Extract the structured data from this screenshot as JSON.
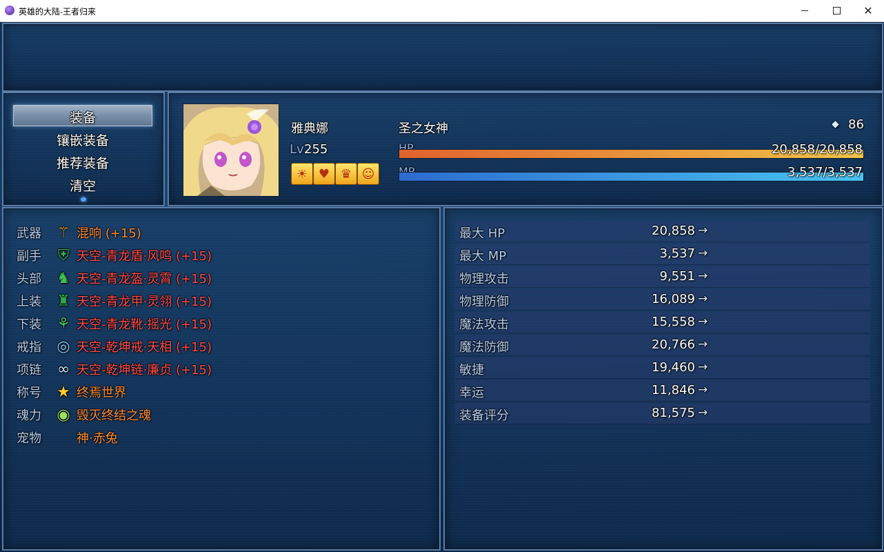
{
  "window": {
    "title": "英雄的大陆-王者归来"
  },
  "commands": [
    "装备",
    "镶嵌装备",
    "推荐装备",
    "清空"
  ],
  "actor": {
    "name": "雅典娜",
    "level_label": "Lv",
    "level": "255",
    "class": "圣之女神",
    "gems": "86",
    "hp_label": "HP",
    "hp_text": "20,858/20,858",
    "hp_ratio": 1.0,
    "mp_label": "MP",
    "mp_text": "3,537/3,537",
    "mp_ratio": 1.0,
    "state_icons": [
      "sun-state-icon",
      "heart-state-icon",
      "crown-state-icon",
      "angel-state-icon"
    ]
  },
  "slots": [
    {
      "type": "武器",
      "icon": "staff-icon",
      "name": "混响 (+15)",
      "color": "orange"
    },
    {
      "type": "副手",
      "icon": "dragon-shield-icon",
      "name": "天空-青龙盾·风鸣 (+15)",
      "color": "red"
    },
    {
      "type": "头部",
      "icon": "dragon-helm-icon",
      "name": "天空-青龙盔·灵霄 (+15)",
      "color": "red"
    },
    {
      "type": "上装",
      "icon": "dragon-armor-icon",
      "name": "天空-青龙甲·灵翎 (+15)",
      "color": "red"
    },
    {
      "type": "下装",
      "icon": "dragon-boots-icon",
      "name": "天空-青龙靴·摇光 (+15)",
      "color": "red"
    },
    {
      "type": "戒指",
      "icon": "ring-icon",
      "name": "天空-乾坤戒·天相  (+15)",
      "color": "red"
    },
    {
      "type": "项链",
      "icon": "necklace-icon",
      "name": "天空-乾坤链·廉贞 (+15)",
      "color": "red"
    },
    {
      "type": "称号",
      "icon": "star-icon",
      "name": "终焉世界",
      "color": "orange"
    },
    {
      "type": "魂力",
      "icon": "eye-orb-icon",
      "name": "毁灭终结之魂",
      "color": "orange"
    },
    {
      "type": "宠物",
      "icon": "",
      "name": "神·赤兔",
      "color": "orange"
    }
  ],
  "params": [
    {
      "name": "最大 HP",
      "value": "20,858"
    },
    {
      "name": "最大 MP",
      "value": "3,537"
    },
    {
      "name": "物理攻击",
      "value": "9,551"
    },
    {
      "name": "物理防御",
      "value": "16,089"
    },
    {
      "name": "魔法攻击",
      "value": "15,558"
    },
    {
      "name": "魔法防御",
      "value": "20,766"
    },
    {
      "name": "敏捷",
      "value": "19,460"
    },
    {
      "name": "幸运",
      "value": "11,846"
    },
    {
      "name": "装备评分",
      "value": "81,575"
    }
  ],
  "arrow": "→",
  "gem_glyph": "◆"
}
